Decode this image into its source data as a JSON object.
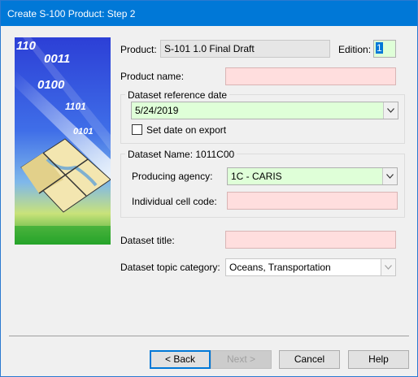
{
  "window": {
    "title": "Create S-100 Product: Step 2"
  },
  "image": {
    "binary_lines": [
      "110",
      "0011",
      "0100",
      "1101",
      "0101"
    ]
  },
  "product": {
    "label": "Product:",
    "value": "S-101 1.0 Final Draft"
  },
  "edition": {
    "label": "Edition:",
    "value": "1"
  },
  "product_name": {
    "label": "Product name:",
    "value": ""
  },
  "dataset_reference_date": {
    "group_label": "Dataset reference date",
    "value": "5/24/2019",
    "set_on_export_label": "Set date on export",
    "set_on_export_checked": false
  },
  "dataset_name": {
    "group_label": "Dataset Name: 1011C00",
    "producing_agency_label": "Producing agency:",
    "producing_agency_value": "1C - CARIS",
    "individual_cell_code_label": "Individual cell code:",
    "individual_cell_code_value": ""
  },
  "dataset_title": {
    "label": "Dataset title:",
    "value": ""
  },
  "dataset_topic_category": {
    "label": "Dataset topic category:",
    "value": "Oceans, Transportation"
  },
  "buttons": {
    "back": "< Back",
    "next": "Next >",
    "cancel": "Cancel",
    "help": "Help"
  },
  "colors": {
    "title_bar": "#0078d7",
    "required_field": "#ffdede",
    "valid_field": "#dfffd8",
    "readonly_field": "#e6e6e6"
  }
}
